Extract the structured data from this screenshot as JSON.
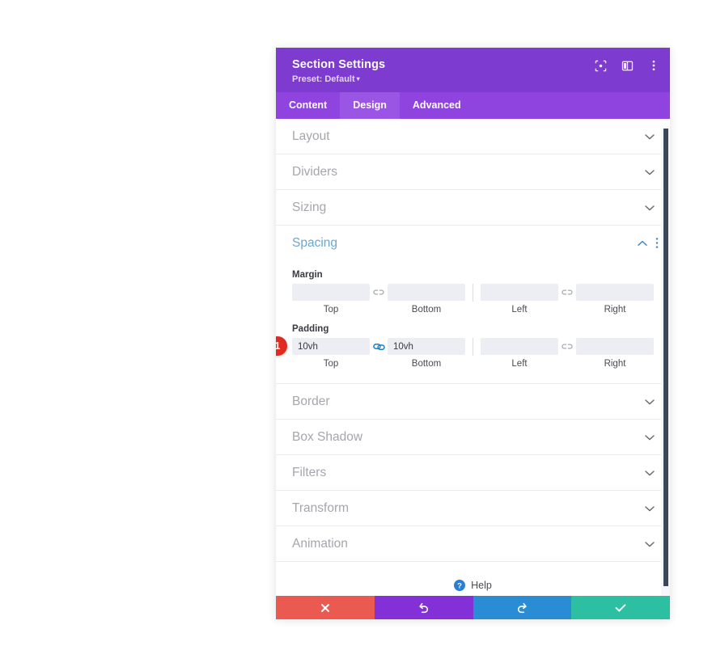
{
  "panel": {
    "title": "Section Settings",
    "preset_label": "Preset: Default",
    "preset_caret": "▾",
    "header_icons": [
      {
        "name": "focus-icon"
      },
      {
        "name": "split-view-icon"
      },
      {
        "name": "more-options-icon"
      }
    ]
  },
  "tabs": [
    {
      "label": "Content",
      "active": false
    },
    {
      "label": "Design",
      "active": true
    },
    {
      "label": "Advanced",
      "active": false
    }
  ],
  "sections": [
    {
      "label": "Layout",
      "open": false
    },
    {
      "label": "Dividers",
      "open": false
    },
    {
      "label": "Sizing",
      "open": false
    }
  ],
  "spacing": {
    "title": "Spacing",
    "groups": [
      {
        "label": "Margin",
        "link_left": {
          "state": "unlinked"
        },
        "link_right": {
          "state": "unlinked"
        },
        "fields": [
          {
            "label": "Top",
            "value": ""
          },
          {
            "label": "Bottom",
            "value": ""
          },
          {
            "label": "Left",
            "value": ""
          },
          {
            "label": "Right",
            "value": ""
          }
        ]
      },
      {
        "label": "Padding",
        "badge": "1",
        "link_left": {
          "state": "linked"
        },
        "link_right": {
          "state": "unlinked"
        },
        "fields": [
          {
            "label": "Top",
            "value": "10vh"
          },
          {
            "label": "Bottom",
            "value": "10vh"
          },
          {
            "label": "Left",
            "value": ""
          },
          {
            "label": "Right",
            "value": ""
          }
        ]
      }
    ]
  },
  "sections_after": [
    {
      "label": "Border",
      "open": false
    },
    {
      "label": "Box Shadow",
      "open": false
    },
    {
      "label": "Filters",
      "open": false
    },
    {
      "label": "Transform",
      "open": false
    },
    {
      "label": "Animation",
      "open": false
    }
  ],
  "help": {
    "label": "Help",
    "icon": "question-circle-icon"
  },
  "actions": [
    {
      "name": "cancel-button",
      "icon": "times-icon",
      "color": "#ea5a51"
    },
    {
      "name": "undo-button",
      "icon": "undo-icon",
      "color": "#8330d6"
    },
    {
      "name": "redo-button",
      "icon": "redo-icon",
      "color": "#2a8cd4"
    },
    {
      "name": "save-button",
      "icon": "check-icon",
      "color": "#2cbfa1"
    }
  ],
  "colors": {
    "header_purple": "#7e3bd0",
    "tabbar_purple": "#8f44df",
    "tab_active": "#9b55e4",
    "section_teal": "#6ba7cf",
    "badge_red": "#e02b20",
    "link_active_blue": "#1c7fc4"
  }
}
